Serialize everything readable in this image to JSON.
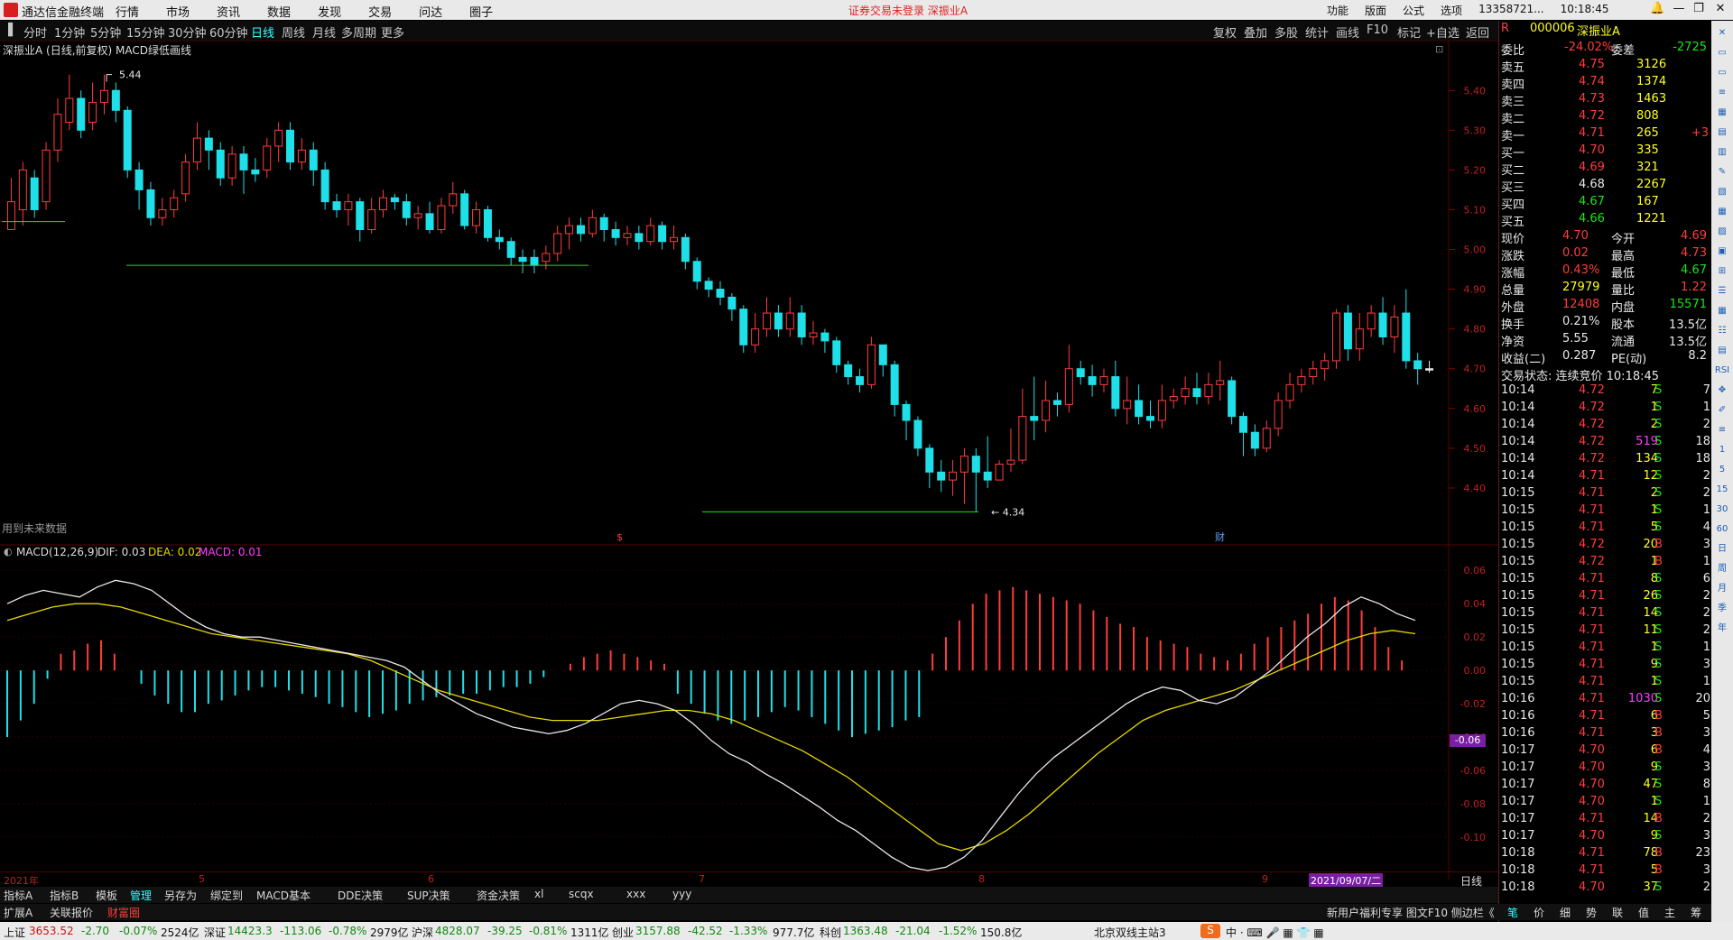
{
  "menubar": {
    "app_title": "通达信金融终端",
    "menus": [
      "行情",
      "市场",
      "资讯",
      "数据",
      "发现",
      "交易",
      "问达",
      "圈子"
    ],
    "notice": "证券交易未登录  深振业A",
    "right_items": [
      "功能",
      "版面",
      "公式",
      "选项"
    ],
    "account": "13358721...",
    "time": "10:18:45"
  },
  "periods": [
    "分时",
    "1分钟",
    "5分钟",
    "15分钟",
    "30分钟",
    "60分钟",
    "日线",
    "周线",
    "月线",
    "多周期",
    "更多"
  ],
  "active_period": "日线",
  "chart_tools": [
    "复权",
    "叠加",
    "多股",
    "统计",
    "画线",
    "F10",
    "标记",
    "+自选",
    "返回"
  ],
  "main_title": "深振业A (日线,前复权)",
  "indicator_overlay": "MACD绿低画线",
  "future_note": "用到未来数据",
  "high_label": "5.44",
  "low_label": "4.34",
  "event_marks": [
    "$",
    "财"
  ],
  "price_axis": [
    "5.40",
    "5.30",
    "5.20",
    "5.10",
    "5.00",
    "4.90",
    "4.80",
    "4.70",
    "4.60",
    "4.50",
    "4.40"
  ],
  "macd": {
    "name": "MACD(12,26,9)",
    "dif": "DIF: 0.03",
    "dea": "DEA: 0.02",
    "macd": "MACD: 0.01",
    "current": "-0.06"
  },
  "macd_axis": [
    "0.06",
    "0.04",
    "0.02",
    "0.00",
    "-0.02",
    "-0.04",
    "-0.06",
    "-0.08",
    "-0.10"
  ],
  "date_axis": {
    "start": "2021年",
    "m5": "5",
    "m6": "6",
    "m7": "7",
    "m8": "8",
    "m9": "9",
    "cursor": "2021/09/07/二",
    "period": "日线"
  },
  "chart_data": {
    "type": "candlestick",
    "title": "深振业A (日线,前复权)",
    "ylim": [
      4.3,
      5.48
    ],
    "candles": [
      [
        5.05,
        5.12,
        5.08,
        5.18
      ],
      [
        5.1,
        5.2,
        5.06,
        5.22
      ],
      [
        5.18,
        5.1,
        5.08,
        5.2
      ],
      [
        5.12,
        5.25,
        5.1,
        5.27
      ],
      [
        5.25,
        5.34,
        5.22,
        5.38
      ],
      [
        5.32,
        5.38,
        5.3,
        5.44
      ],
      [
        5.38,
        5.3,
        5.28,
        5.4
      ],
      [
        5.32,
        5.37,
        5.3,
        5.42
      ],
      [
        5.37,
        5.4,
        5.34,
        5.44
      ],
      [
        5.4,
        5.35,
        5.32,
        5.42
      ],
      [
        5.35,
        5.2,
        5.18,
        5.36
      ],
      [
        5.2,
        5.15,
        5.1,
        5.22
      ],
      [
        5.15,
        5.08,
        5.06,
        5.17
      ],
      [
        5.08,
        5.1,
        5.06,
        5.13
      ],
      [
        5.1,
        5.13,
        5.08,
        5.15
      ],
      [
        5.14,
        5.22,
        5.12,
        5.24
      ],
      [
        5.22,
        5.28,
        5.2,
        5.32
      ],
      [
        5.28,
        5.25,
        5.2,
        5.3
      ],
      [
        5.25,
        5.18,
        5.16,
        5.27
      ],
      [
        5.18,
        5.24,
        5.16,
        5.26
      ],
      [
        5.24,
        5.2,
        5.14,
        5.26
      ],
      [
        5.2,
        5.19,
        5.17,
        5.23
      ],
      [
        5.2,
        5.26,
        5.18,
        5.28
      ],
      [
        5.26,
        5.3,
        5.22,
        5.32
      ],
      [
        5.3,
        5.22,
        5.2,
        5.32
      ],
      [
        5.22,
        5.25,
        5.2,
        5.28
      ],
      [
        5.25,
        5.2,
        5.16,
        5.27
      ],
      [
        5.2,
        5.12,
        5.1,
        5.22
      ],
      [
        5.12,
        5.1,
        5.08,
        5.14
      ],
      [
        5.1,
        5.12,
        5.06,
        5.14
      ],
      [
        5.12,
        5.05,
        5.02,
        5.13
      ],
      [
        5.05,
        5.1,
        5.04,
        5.13
      ],
      [
        5.1,
        5.13,
        5.08,
        5.15
      ],
      [
        5.13,
        5.12,
        5.1,
        5.14
      ],
      [
        5.12,
        5.08,
        5.06,
        5.14
      ],
      [
        5.08,
        5.09,
        5.05,
        5.11
      ],
      [
        5.09,
        5.05,
        5.04,
        5.12
      ],
      [
        5.05,
        5.11,
        5.04,
        5.13
      ],
      [
        5.11,
        5.14,
        5.09,
        5.17
      ],
      [
        5.14,
        5.06,
        5.05,
        5.15
      ],
      [
        5.06,
        5.1,
        5.04,
        5.12
      ],
      [
        5.1,
        5.03,
        5.02,
        5.11
      ],
      [
        5.03,
        5.02,
        5.0,
        5.05
      ],
      [
        5.02,
        4.98,
        4.96,
        5.03
      ],
      [
        4.98,
        4.97,
        4.94,
        5.0
      ],
      [
        4.98,
        4.96,
        4.94,
        5.0
      ],
      [
        4.97,
        4.99,
        4.95,
        5.01
      ],
      [
        4.99,
        5.04,
        4.97,
        5.06
      ],
      [
        5.04,
        5.06,
        5.0,
        5.08
      ],
      [
        5.06,
        5.04,
        5.02,
        5.08
      ],
      [
        5.04,
        5.08,
        5.03,
        5.1
      ],
      [
        5.08,
        5.05,
        5.02,
        5.09
      ],
      [
        5.05,
        5.03,
        5.01,
        5.07
      ],
      [
        5.03,
        5.04,
        5.01,
        5.06
      ],
      [
        5.04,
        5.02,
        5.0,
        5.06
      ],
      [
        5.02,
        5.06,
        5.01,
        5.08
      ],
      [
        5.06,
        5.02,
        5.0,
        5.07
      ],
      [
        5.02,
        5.03,
        5.0,
        5.06
      ],
      [
        5.03,
        4.97,
        4.95,
        5.04
      ],
      [
        4.97,
        4.92,
        4.9,
        4.98
      ],
      [
        4.92,
        4.9,
        4.88,
        4.93
      ],
      [
        4.9,
        4.88,
        4.86,
        4.92
      ],
      [
        4.88,
        4.85,
        4.82,
        4.89
      ],
      [
        4.85,
        4.76,
        4.74,
        4.86
      ],
      [
        4.76,
        4.8,
        4.74,
        4.84
      ],
      [
        4.8,
        4.84,
        4.78,
        4.88
      ],
      [
        4.84,
        4.8,
        4.78,
        4.86
      ],
      [
        4.8,
        4.84,
        4.78,
        4.88
      ],
      [
        4.84,
        4.78,
        4.76,
        4.86
      ],
      [
        4.78,
        4.79,
        4.76,
        4.82
      ],
      [
        4.79,
        4.77,
        4.74,
        4.8
      ],
      [
        4.77,
        4.71,
        4.69,
        4.78
      ],
      [
        4.71,
        4.68,
        4.66,
        4.72
      ],
      [
        4.68,
        4.66,
        4.64,
        4.7
      ],
      [
        4.66,
        4.76,
        4.65,
        4.78
      ],
      [
        4.76,
        4.71,
        4.68,
        4.74
      ],
      [
        4.71,
        4.61,
        4.58,
        4.72
      ],
      [
        4.61,
        4.57,
        4.52,
        4.62
      ],
      [
        4.57,
        4.5,
        4.48,
        4.58
      ],
      [
        4.5,
        4.44,
        4.4,
        4.51
      ],
      [
        4.44,
        4.42,
        4.39,
        4.47
      ],
      [
        4.42,
        4.44,
        4.38,
        4.47
      ],
      [
        4.44,
        4.48,
        4.36,
        4.5
      ],
      [
        4.48,
        4.44,
        4.34,
        4.5
      ],
      [
        4.44,
        4.42,
        4.4,
        4.53
      ],
      [
        4.42,
        4.46,
        4.43,
        4.47
      ],
      [
        4.46,
        4.47,
        4.44,
        4.55
      ],
      [
        4.47,
        4.58,
        4.46,
        4.65
      ],
      [
        4.58,
        4.57,
        4.52,
        4.68
      ],
      [
        4.57,
        4.62,
        4.54,
        4.67
      ],
      [
        4.62,
        4.61,
        4.58,
        4.64
      ],
      [
        4.61,
        4.7,
        4.59,
        4.76
      ],
      [
        4.7,
        4.68,
        4.66,
        4.72
      ],
      [
        4.68,
        4.66,
        4.63,
        4.71
      ],
      [
        4.66,
        4.68,
        4.64,
        4.7
      ],
      [
        4.68,
        4.6,
        4.58,
        4.72
      ],
      [
        4.6,
        4.62,
        4.56,
        4.68
      ],
      [
        4.62,
        4.58,
        4.56,
        4.66
      ],
      [
        4.58,
        4.57,
        4.55,
        4.62
      ],
      [
        4.57,
        4.62,
        4.55,
        4.66
      ],
      [
        4.62,
        4.63,
        4.6,
        4.65
      ],
      [
        4.63,
        4.65,
        4.61,
        4.68
      ],
      [
        4.65,
        4.63,
        4.61,
        4.69
      ],
      [
        4.63,
        4.66,
        4.61,
        4.69
      ],
      [
        4.66,
        4.67,
        4.62,
        4.72
      ],
      [
        4.67,
        4.58,
        4.56,
        4.68
      ],
      [
        4.58,
        4.54,
        4.48,
        4.59
      ],
      [
        4.54,
        4.5,
        4.48,
        4.56
      ],
      [
        4.5,
        4.55,
        4.49,
        4.57
      ],
      [
        4.55,
        4.62,
        4.53,
        4.64
      ],
      [
        4.62,
        4.66,
        4.6,
        4.69
      ],
      [
        4.66,
        4.68,
        4.64,
        4.7
      ],
      [
        4.68,
        4.7,
        4.66,
        4.72
      ],
      [
        4.7,
        4.72,
        4.67,
        4.74
      ],
      [
        4.72,
        4.84,
        4.7,
        4.85
      ],
      [
        4.84,
        4.75,
        4.72,
        4.86
      ],
      [
        4.75,
        4.8,
        4.72,
        4.84
      ],
      [
        4.8,
        4.84,
        4.78,
        4.86
      ],
      [
        4.84,
        4.78,
        4.76,
        4.88
      ],
      [
        4.78,
        4.83,
        4.74,
        4.86
      ],
      [
        4.84,
        4.72,
        4.7,
        4.9
      ],
      [
        4.72,
        4.7,
        4.66,
        4.74
      ],
      [
        4.7,
        4.7,
        4.69,
        4.72
      ]
    ],
    "macd_hist": [
      -0.04,
      -0.03,
      -0.02,
      -0.005,
      0.01,
      0.012,
      0.016,
      0.018,
      0.01,
      0.0,
      -0.008,
      -0.015,
      -0.02,
      -0.025,
      -0.025,
      -0.02,
      -0.018,
      -0.015,
      -0.012,
      -0.01,
      -0.01,
      -0.012,
      -0.014,
      -0.016,
      -0.02,
      -0.022,
      -0.025,
      -0.028,
      -0.026,
      -0.024,
      -0.02,
      -0.018,
      -0.016,
      -0.015,
      -0.014,
      -0.014,
      -0.012,
      -0.01,
      -0.01,
      -0.008,
      -0.004,
      0.0,
      0.004,
      0.008,
      0.01,
      0.012,
      0.01,
      0.008,
      0.006,
      0.004,
      -0.014,
      -0.02,
      -0.026,
      -0.03,
      -0.032,
      -0.03,
      -0.028,
      -0.025,
      -0.022,
      -0.024,
      -0.028,
      -0.032,
      -0.036,
      -0.04,
      -0.038,
      -0.036,
      -0.034,
      -0.03,
      -0.028,
      0.01,
      0.02,
      0.03,
      0.04,
      0.046,
      0.048,
      0.05,
      0.048,
      0.046,
      0.044,
      0.042,
      0.04,
      0.036,
      0.032,
      0.028,
      0.026,
      0.02,
      0.018,
      0.016,
      0.014,
      0.01,
      0.008,
      0.006,
      0.01,
      0.016,
      0.02,
      0.026,
      0.03,
      0.034,
      0.04,
      0.044,
      0.042,
      0.036,
      0.026,
      0.014,
      0.006
    ],
    "dif": [
      0.04,
      0.045,
      0.048,
      0.046,
      0.044,
      0.05,
      0.054,
      0.052,
      0.048,
      0.04,
      0.032,
      0.026,
      0.022,
      0.02,
      0.02,
      0.018,
      0.016,
      0.014,
      0.012,
      0.01,
      0.008,
      0.006,
      0.002,
      -0.006,
      -0.014,
      -0.02,
      -0.026,
      -0.03,
      -0.034,
      -0.036,
      -0.038,
      -0.036,
      -0.032,
      -0.026,
      -0.02,
      -0.018,
      -0.02,
      -0.024,
      -0.032,
      -0.042,
      -0.05,
      -0.055,
      -0.062,
      -0.068,
      -0.075,
      -0.082,
      -0.09,
      -0.096,
      -0.104,
      -0.112,
      -0.118,
      -0.12,
      -0.118,
      -0.112,
      -0.102,
      -0.088,
      -0.074,
      -0.062,
      -0.052,
      -0.044,
      -0.036,
      -0.028,
      -0.02,
      -0.014,
      -0.01,
      -0.012,
      -0.018,
      -0.02,
      -0.016,
      -0.008,
      0.0,
      0.01,
      0.02,
      0.028,
      0.038,
      0.044,
      0.04,
      0.034,
      0.03
    ],
    "dea": [
      0.03,
      0.034,
      0.038,
      0.04,
      0.04,
      0.038,
      0.034,
      0.03,
      0.026,
      0.022,
      0.02,
      0.018,
      0.016,
      0.014,
      0.012,
      0.01,
      0.006,
      0.0,
      -0.006,
      -0.012,
      -0.016,
      -0.02,
      -0.024,
      -0.028,
      -0.03,
      -0.03,
      -0.03,
      -0.028,
      -0.026,
      -0.024,
      -0.024,
      -0.026,
      -0.03,
      -0.036,
      -0.042,
      -0.048,
      -0.056,
      -0.064,
      -0.074,
      -0.084,
      -0.094,
      -0.104,
      -0.108,
      -0.104,
      -0.096,
      -0.086,
      -0.074,
      -0.062,
      -0.05,
      -0.04,
      -0.03,
      -0.024,
      -0.02,
      -0.016,
      -0.012,
      -0.006,
      0.0,
      0.006,
      0.012,
      0.018,
      0.022,
      0.024,
      0.022
    ]
  },
  "quote": {
    "code": "000006",
    "name": "深振业A",
    "weibi_label": "委比",
    "weibi": "-24.02%",
    "weicha_label": "委差",
    "weicha": "-2725",
    "asks": [
      {
        "label": "卖五",
        "price": "4.75",
        "vol": "3126",
        "chg": ""
      },
      {
        "label": "卖四",
        "price": "4.74",
        "vol": "1374",
        "chg": ""
      },
      {
        "label": "卖三",
        "price": "4.73",
        "vol": "1463",
        "chg": ""
      },
      {
        "label": "卖二",
        "price": "4.72",
        "vol": "808",
        "chg": ""
      },
      {
        "label": "卖一",
        "price": "4.71",
        "vol": "265",
        "chg": "+3"
      }
    ],
    "bids": [
      {
        "label": "买一",
        "price": "4.70",
        "vol": "335",
        "pc": "red"
      },
      {
        "label": "买二",
        "price": "4.69",
        "vol": "321",
        "pc": "red"
      },
      {
        "label": "买三",
        "price": "4.68",
        "vol": "2267",
        "pc": "wht"
      },
      {
        "label": "买四",
        "price": "4.67",
        "vol": "167",
        "pc": "grn"
      },
      {
        "label": "买五",
        "price": "4.66",
        "vol": "1221",
        "pc": "grn"
      }
    ],
    "stats": [
      {
        "l1": "现价",
        "v1": "4.70",
        "c1": "red",
        "l2": "今开",
        "v2": "4.69",
        "c2": "red"
      },
      {
        "l1": "涨跌",
        "v1": "0.02",
        "c1": "red",
        "l2": "最高",
        "v2": "4.73",
        "c2": "red"
      },
      {
        "l1": "涨幅",
        "v1": "0.43%",
        "c1": "red",
        "l2": "最低",
        "v2": "4.67",
        "c2": "grn"
      },
      {
        "l1": "总量",
        "v1": "27979",
        "c1": "yel",
        "l2": "量比",
        "v2": "1.22",
        "c2": "red"
      },
      {
        "l1": "外盘",
        "v1": "12408",
        "c1": "red",
        "l2": "内盘",
        "v2": "15571",
        "c2": "grn"
      },
      {
        "l1": "换手",
        "v1": "0.21%",
        "c1": "wht",
        "l2": "股本",
        "v2": "13.5亿",
        "c2": "wht"
      },
      {
        "l1": "净资",
        "v1": "5.55",
        "c1": "wht",
        "l2": "流通",
        "v2": "13.5亿",
        "c2": "wht"
      },
      {
        "l1": "收益(二)",
        "v1": "0.287",
        "c1": "wht",
        "l2": "PE(动)",
        "v2": "8.2",
        "c2": "wht"
      }
    ],
    "trade_status": "交易状态: 连续竞价 10:18:45"
  },
  "ticks": [
    [
      "10:14",
      "4.72",
      "7",
      "S",
      "7"
    ],
    [
      "10:14",
      "4.72",
      "1",
      "S",
      "1"
    ],
    [
      "10:14",
      "4.72",
      "2",
      "S",
      "2"
    ],
    [
      "10:14",
      "4.72",
      "519",
      "S",
      "18"
    ],
    [
      "10:14",
      "4.72",
      "134",
      "S",
      "18"
    ],
    [
      "10:14",
      "4.71",
      "12",
      "S",
      "2"
    ],
    [
      "10:15",
      "4.71",
      "2",
      "S",
      "2"
    ],
    [
      "10:15",
      "4.71",
      "1",
      "S",
      "1"
    ],
    [
      "10:15",
      "4.71",
      "5",
      "S",
      "4"
    ],
    [
      "10:15",
      "4.72",
      "20",
      "B",
      "3"
    ],
    [
      "10:15",
      "4.72",
      "1",
      "B",
      "1"
    ],
    [
      "10:15",
      "4.71",
      "8",
      "S",
      "6"
    ],
    [
      "10:15",
      "4.71",
      "26",
      "S",
      "2"
    ],
    [
      "10:15",
      "4.71",
      "14",
      "S",
      "2"
    ],
    [
      "10:15",
      "4.71",
      "11",
      "S",
      "2"
    ],
    [
      "10:15",
      "4.71",
      "1",
      "S",
      "1"
    ],
    [
      "10:15",
      "4.71",
      "9",
      "S",
      "3"
    ],
    [
      "10:15",
      "4.71",
      "1",
      "S",
      "1"
    ],
    [
      "10:16",
      "4.71",
      "1030",
      "S",
      "20"
    ],
    [
      "10:16",
      "4.71",
      "6",
      "B",
      "5"
    ],
    [
      "10:16",
      "4.71",
      "3",
      "B",
      "3"
    ],
    [
      "10:17",
      "4.70",
      "6",
      "B",
      "4"
    ],
    [
      "10:17",
      "4.70",
      "9",
      "S",
      "3"
    ],
    [
      "10:17",
      "4.70",
      "47",
      "S",
      "8"
    ],
    [
      "10:17",
      "4.70",
      "1",
      "S",
      "1"
    ],
    [
      "10:17",
      "4.71",
      "14",
      "B",
      "2"
    ],
    [
      "10:17",
      "4.70",
      "9",
      "S",
      "3"
    ],
    [
      "10:18",
      "4.71",
      "78",
      "B",
      "23"
    ],
    [
      "10:18",
      "4.71",
      "5",
      "B",
      "3"
    ],
    [
      "10:18",
      "4.70",
      "37",
      "S",
      "2"
    ]
  ],
  "tabs_row1": [
    "指标A",
    "指标B",
    "模板",
    "管理",
    "另存为",
    "绑定到",
    "MACD基本",
    "DDE决策",
    "SUP决策",
    "资金决策",
    "xl",
    "scqx",
    "xxx",
    "yyy"
  ],
  "tabs_row2": [
    "扩展A",
    "关联报价",
    "财富圈"
  ],
  "right_tabs": [
    "笔",
    "价",
    "细",
    "势",
    "联",
    "值",
    "主",
    "筹"
  ],
  "promo": "新用户福利专享 图文F10 侧边栏《",
  "status": {
    "sh": "上证",
    "sh_v": "3653.52",
    "sh_c": "-2.70",
    "sh_p": "-0.07%",
    "sh_a": "2524亿",
    "sz": "深证",
    "sz_v": "14423.3",
    "sz_c": "-113.06",
    "sz_p": "-0.78%",
    "sz_a": "2979亿",
    "hs": "沪深",
    "hs_v": "4828.07",
    "hs_c": "-39.25",
    "hs_p": "-0.81%",
    "hs_a": "1311亿",
    "cy": "创业",
    "cy_v": "3157.88",
    "cy_c": "-42.52",
    "cy_p": "-1.33%",
    "cy_a": "977.7亿",
    "kc": "科创",
    "kc_v": "1363.48",
    "kc_c": "-21.04",
    "kc_p": "-1.52%",
    "kc_a": "150.8亿",
    "server": "北京双线主站3"
  },
  "colors": {
    "up": "#ff3c3c",
    "down": "#1fe0e8",
    "dif": "#e8e8e8",
    "dea": "#e8d800",
    "grid": "#5a0000"
  }
}
